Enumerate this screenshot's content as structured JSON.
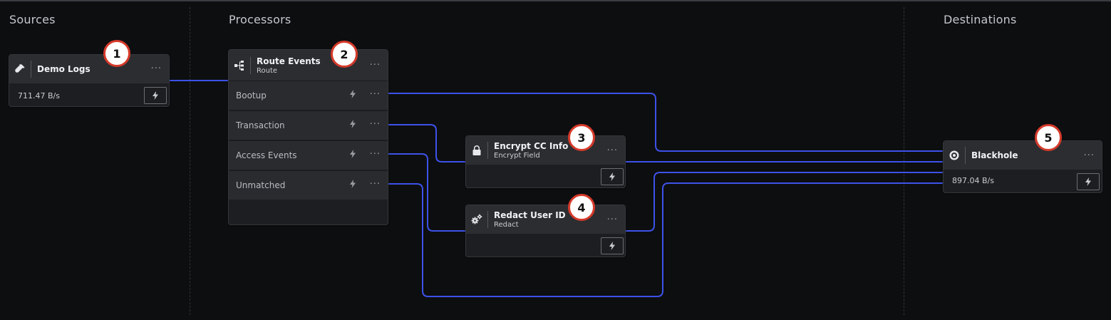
{
  "columns": {
    "sources": "Sources",
    "processors": "Processors",
    "destinations": "Destinations"
  },
  "nodes": {
    "demo_logs": {
      "title": "Demo Logs",
      "rate": "711.47 B/s",
      "icon": "flask-icon",
      "badge": "1"
    },
    "route_events": {
      "title": "Route Events",
      "subtitle": "Route",
      "icon": "route-icon",
      "badge": "2",
      "routes": [
        "Bootup",
        "Transaction",
        "Access Events",
        "Unmatched"
      ]
    },
    "encrypt_cc": {
      "title": "Encrypt CC Info",
      "subtitle": "Encrypt Field",
      "icon": "lock-icon",
      "badge": "3"
    },
    "redact_user": {
      "title": "Redact User ID",
      "subtitle": "Redact",
      "icon": "gears-icon",
      "badge": "4"
    },
    "blackhole": {
      "title": "Blackhole",
      "rate": "897.04 B/s",
      "icon": "target-icon",
      "badge": "5"
    }
  },
  "more_glyph": "···",
  "colors": {
    "edge": "#3d52e8",
    "badge_border": "#d63a2a",
    "background": "#0d0e10"
  }
}
